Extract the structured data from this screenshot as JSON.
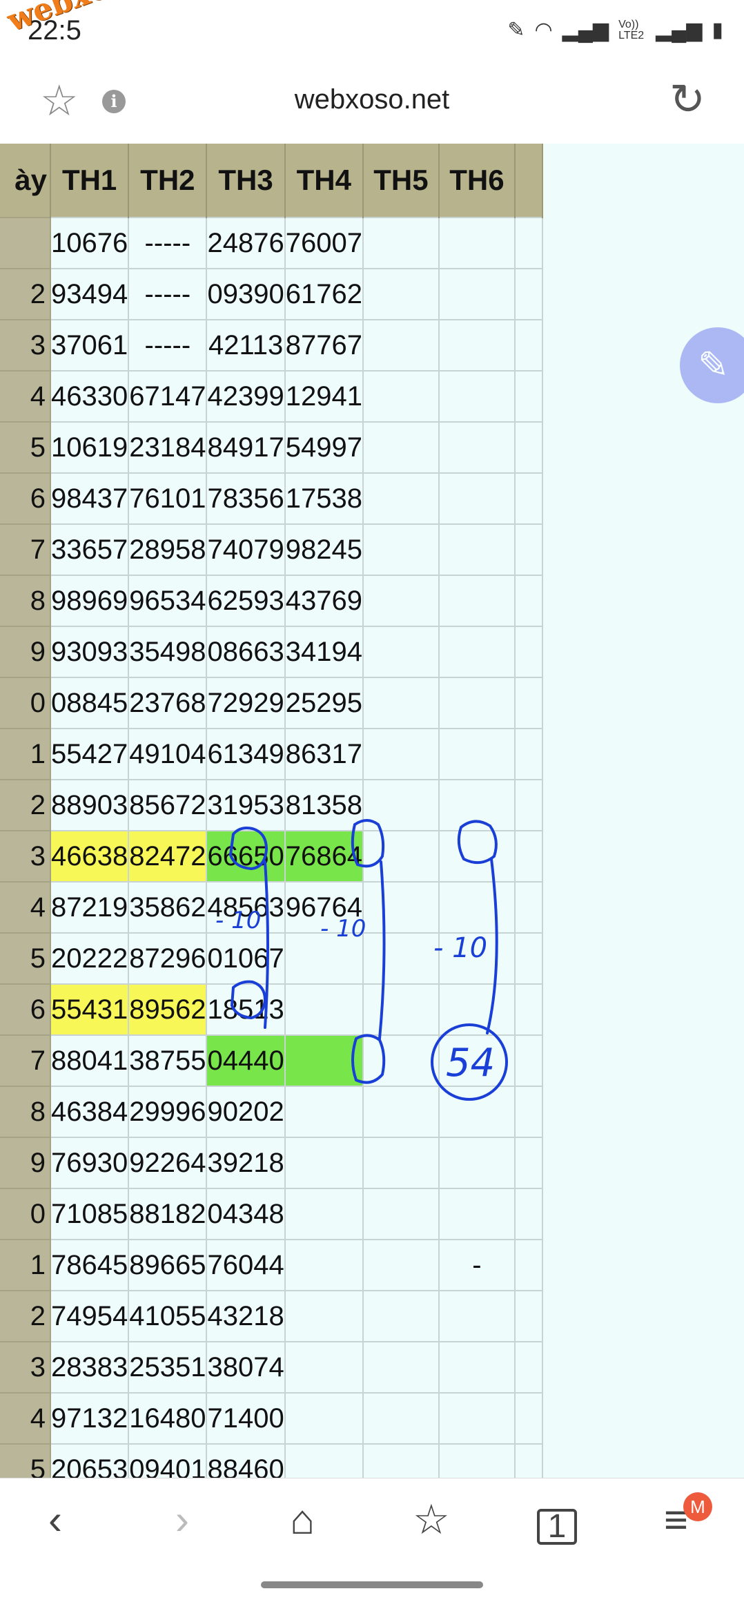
{
  "status": {
    "time": "22:5",
    "watermark": "webxoso.net",
    "icons": [
      "pen-icon",
      "wifi-icon",
      "signal-icon",
      "volte-icon",
      "signal-icon",
      "battery-icon"
    ],
    "volte_label": "Vo)) LTE2"
  },
  "urlbar": {
    "url": "webxoso.net"
  },
  "table": {
    "headers": [
      "ày",
      "TH1",
      "TH2",
      "TH3",
      "TH4",
      "TH5",
      "TH6",
      ""
    ],
    "rows": [
      {
        "day": "",
        "cells": [
          "10676",
          "-----",
          "24876",
          "76007",
          "",
          "",
          ""
        ]
      },
      {
        "day": "2",
        "cells": [
          "93494",
          "-----",
          "09390",
          "61762",
          "",
          "",
          ""
        ]
      },
      {
        "day": "3",
        "cells": [
          "37061",
          "-----",
          "42113",
          "87767",
          "",
          "",
          ""
        ]
      },
      {
        "day": "4",
        "cells": [
          "46330",
          "67147",
          "42399",
          "12941",
          "",
          "",
          ""
        ]
      },
      {
        "day": "5",
        "cells": [
          "10619",
          "23184",
          "84917",
          "54997",
          "",
          "",
          ""
        ]
      },
      {
        "day": "6",
        "cells": [
          "98437",
          "76101",
          "78356",
          "17538",
          "",
          "",
          ""
        ]
      },
      {
        "day": "7",
        "cells": [
          "33657",
          "28958",
          "74079",
          "98245",
          "",
          "",
          ""
        ]
      },
      {
        "day": "8",
        "cells": [
          "98969",
          "96534",
          "62593",
          "43769",
          "",
          "",
          ""
        ]
      },
      {
        "day": "9",
        "cells": [
          "93093",
          "35498",
          "08663",
          "34194",
          "",
          "",
          ""
        ]
      },
      {
        "day": "0",
        "cells": [
          "08845",
          "23768",
          "72929",
          "25295",
          "",
          "",
          ""
        ]
      },
      {
        "day": "1",
        "cells": [
          "55427",
          "49104",
          "61349",
          "86317",
          "",
          "",
          ""
        ]
      },
      {
        "day": "2",
        "cells": [
          "88903",
          "85672",
          "31953",
          "81358",
          "",
          "",
          ""
        ]
      },
      {
        "day": "3",
        "cells": [
          "46638",
          "82472",
          "66650",
          "76864",
          "",
          "",
          ""
        ]
      },
      {
        "day": "4",
        "cells": [
          "87219",
          "35862",
          "48563",
          "96764",
          "",
          "",
          ""
        ]
      },
      {
        "day": "5",
        "cells": [
          "20222",
          "87296",
          "01067",
          "",
          "",
          "",
          ""
        ]
      },
      {
        "day": "6",
        "cells": [
          "55431",
          "89562",
          "18513",
          "",
          "",
          "",
          ""
        ]
      },
      {
        "day": "7",
        "cells": [
          "88041",
          "38755",
          "04440",
          "",
          "",
          "",
          ""
        ]
      },
      {
        "day": "8",
        "cells": [
          "46384",
          "29996",
          "90202",
          "",
          "",
          "",
          ""
        ]
      },
      {
        "day": "9",
        "cells": [
          "76930",
          "92264",
          "39218",
          "",
          "",
          "",
          ""
        ]
      },
      {
        "day": "0",
        "cells": [
          "71085",
          "88182",
          "04348",
          "",
          "",
          "",
          ""
        ]
      },
      {
        "day": "1",
        "cells": [
          "78645",
          "89665",
          "76044",
          "",
          "",
          "-",
          ""
        ]
      },
      {
        "day": "2",
        "cells": [
          "74954",
          "41055",
          "43218",
          "",
          "",
          "",
          ""
        ]
      },
      {
        "day": "3",
        "cells": [
          "28383",
          "25351",
          "38074",
          "",
          "",
          "",
          ""
        ]
      },
      {
        "day": "4",
        "cells": [
          "97132",
          "16480",
          "71400",
          "",
          "",
          "",
          ""
        ]
      },
      {
        "day": "5",
        "cells": [
          "20653",
          "09401",
          "88460",
          "",
          "",
          "",
          ""
        ]
      }
    ],
    "highlight_colors": {
      "yellow": "#f7f758",
      "green": "#78e64b"
    }
  },
  "annotations": {
    "minus_ten": "- 10",
    "circled": "54",
    "color": "#1a3fd6"
  },
  "nav": {
    "badge": "M",
    "tab_count": "1"
  }
}
